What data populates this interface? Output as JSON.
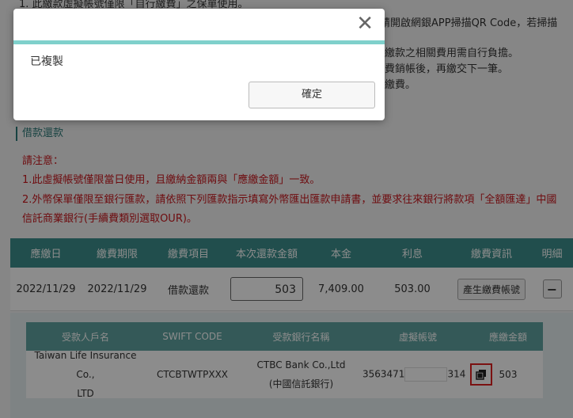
{
  "notice": {
    "line1": "1.   此繳款虛擬帳號僅限「自行繳費」之保單使用。",
    "line2_right": "請開啟網銀APP掃描QR Code，若掃描",
    "line3_right": "繳款之相關費用需自行負擔。",
    "line4_right": "費銷帳後，再繳交下一筆。",
    "line5_right": "繳費。"
  },
  "section_title": "借款還款",
  "warnings": {
    "heading": "請注意：",
    "item1": "1.此虛擬帳號僅限當日使用，且繳納金額兩與「應繳金額」一致。",
    "item2a": "2.外幣保單僅限至銀行匯款，請依照下列匯款指示填寫外幣匯出匯款申請書，並要求往來銀行將款項「全額匯達」中國",
    "item2b": "信託商業銀行(手續費類別選取OUR)。"
  },
  "main_table": {
    "headers": [
      "應繳日",
      "繳費期限",
      "繳費項目",
      "本次還款金額",
      "本金",
      "利息",
      "繳費資訊",
      "明細"
    ],
    "row": {
      "due_date": "2022/11/29",
      "deadline": "2022/11/29",
      "item": "借款還款",
      "amount": "503",
      "principal": "7,409.00",
      "interest": "503.00",
      "gen_button": "產生繳費帳號",
      "toggle": "−"
    }
  },
  "sub_table": {
    "headers": [
      "受款人戶名",
      "SWIFT CODE",
      "受款銀行名稱",
      "虛擬帳號",
      "應繳金額"
    ],
    "row": {
      "payee_line1": "Taiwan Life Insurance Co.,",
      "payee_line2": "LTD",
      "swift": "CTCBTWTPXXX",
      "bank_line1": "CTBC Bank Co.,Ltd",
      "bank_line2": "(中國信託銀行)",
      "account_prefix": "3563471",
      "account_suffix": "314",
      "amount": "503"
    }
  },
  "dialog": {
    "message": "已複製",
    "ok_label": "確定",
    "close_glyph": "✕"
  }
}
